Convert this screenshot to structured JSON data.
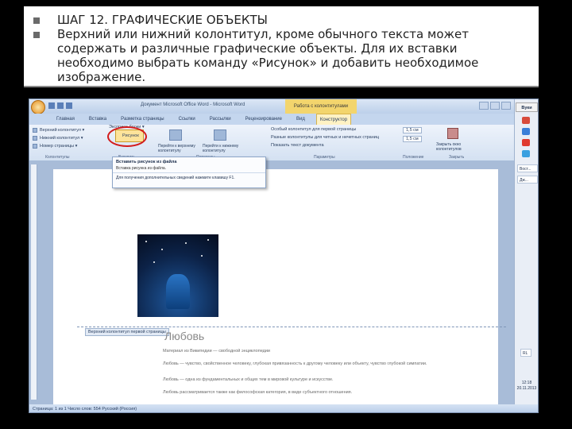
{
  "slide": {
    "bullets": [
      "ШАГ 12. ГРАФИЧЕСКИЕ ОБЪЕКТЫ",
      "Верхний или нижний колонтитул, кроме обычного текста может содержать и различные графические объекты. Для их вставки необходимо выбрать команду «Рисунок» и добавить необходимое изображение."
    ]
  },
  "word": {
    "title": "Документ Microsoft Office Word - Microsoft Word",
    "context_group": "Работа с колонтитулами",
    "tabs": [
      "Главная",
      "Вставка",
      "Разметка страницы",
      "Ссылки",
      "Рассылки",
      "Рецензирование",
      "Вид",
      "Конструктор"
    ],
    "active_tab_index": 7,
    "ribbon": {
      "header_btn": "Верхний колонтитул ▾",
      "footer_btn": "Нижний колонтитул ▾",
      "pagenum_btn": "Номер страницы ▾",
      "datetime_btn": "Экспресс-блоки ▾",
      "picture_btn": "Рисунок",
      "goto_header": "Перейти к верхнему колонтитулу",
      "goto_footer": "Перейти к нижнему колонтитулу",
      "opt1": "Особый колонтитул для первой страницы",
      "opt2": "Разные колонтитулы для четных и нечетных страниц",
      "opt3": "Показать текст документа",
      "pos1": "1,5 см",
      "pos2": "1,5 см",
      "close_btn": "Закрыть окно колонтитулов",
      "groups": [
        "Колонтитулы",
        "Вставить",
        "Переходы",
        "Параметры",
        "Положение",
        "Закрыть"
      ]
    },
    "dropdown": {
      "title": "Вставить рисунок из файла",
      "text": "Вставка рисунка из файла.",
      "help": "Для получения дополнительных сведений нажмите клавишу F1."
    },
    "doc": {
      "header_label": "Верхний колонтитул первой страницы",
      "heading": "Любовь",
      "source_line": "Материал из Википедии — свободной энциклопедии",
      "p1": "Любовь — чувство, свойственное человеку, глубокая привязанность к другому человеку или объекту, чувство глубокой симпатии.",
      "p2": "Любовь — одна из фундаментальных и общих тем в мировой культуре и искусстве.",
      "p3": "Любовь рассматривается также как философская категория, в виде субъектного отношения."
    },
    "status": "Страница: 1 из 1   Число слов: 554   Русский (Россия)",
    "side_panel": {
      "top": "Вуки",
      "entries": [
        "Вост...",
        "Дж..."
      ],
      "lang": "RL",
      "time": "12:18",
      "date": "20.11.2013"
    }
  }
}
